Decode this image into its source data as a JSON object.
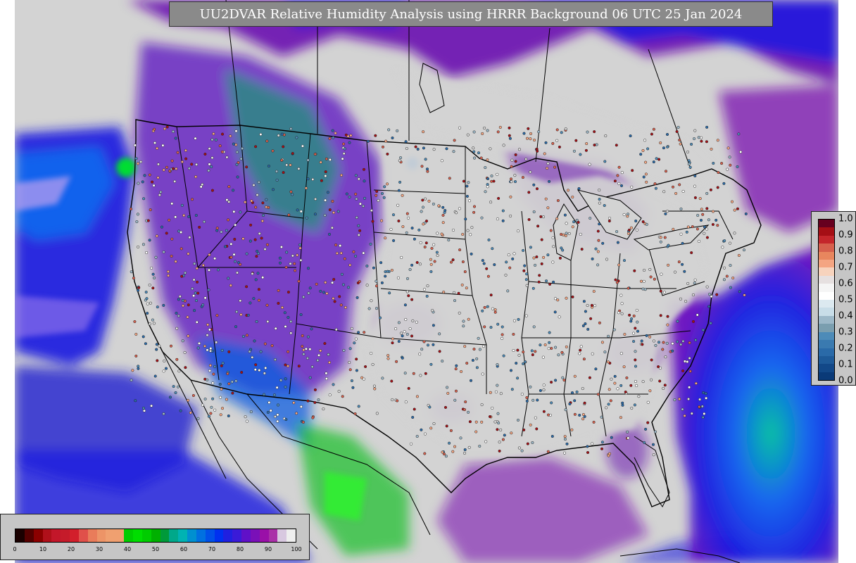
{
  "title": "UU2DVAR Relative Humidity Analysis using HRRR Background 06 UTC 25 Jan 2024",
  "legend_rh": {
    "ticks": [
      "0",
      "10",
      "20",
      "30",
      "40",
      "50",
      "60",
      "70",
      "80",
      "90",
      "100"
    ],
    "colors": [
      "#1a0000",
      "#550000",
      "#8b0000",
      "#b0101a",
      "#c3172a",
      "#c51b2a",
      "#d21f2b",
      "#e0504a",
      "#e97c5a",
      "#ed9467",
      "#f0a070",
      "#f0a070",
      "#00cc00",
      "#00dd00",
      "#00cc00",
      "#00b000",
      "#009a3a",
      "#00a88a",
      "#00b3b3",
      "#0090d0",
      "#0070e0",
      "#0050e8",
      "#0030f0",
      "#2020e0",
      "#3a1ad8",
      "#6010c8",
      "#7a10b8",
      "#9a10a8",
      "#aa30a8",
      "#d8c8e0",
      "#eeeeee"
    ]
  },
  "legend_rh_fraction": {
    "ticks": [
      "1.0",
      "0.9",
      "0.8",
      "0.7",
      "0.6",
      "0.5",
      "0.4",
      "0.3",
      "0.2",
      "0.1",
      "0.0"
    ],
    "colors": [
      "#67001f",
      "#a50f15",
      "#c4262b",
      "#d6604d",
      "#e8865e",
      "#f4a582",
      "#f7d3bd",
      "#e6e0e0",
      "#f5f5f5",
      "#ffffff",
      "#dce9f0",
      "#c8dde8",
      "#9cb8c8",
      "#7a9eaf",
      "#4d8bb8",
      "#3a7ab0",
      "#2a6aa8",
      "#1e5a98",
      "#124888",
      "#0a3a78"
    ]
  },
  "colors": {
    "background": "#d3d3d3",
    "land_dry": "#d0d0d0",
    "ocean_moist": "#1a1ae0",
    "humid_purple": "#7a10b0",
    "humid_green": "#00cc33"
  }
}
